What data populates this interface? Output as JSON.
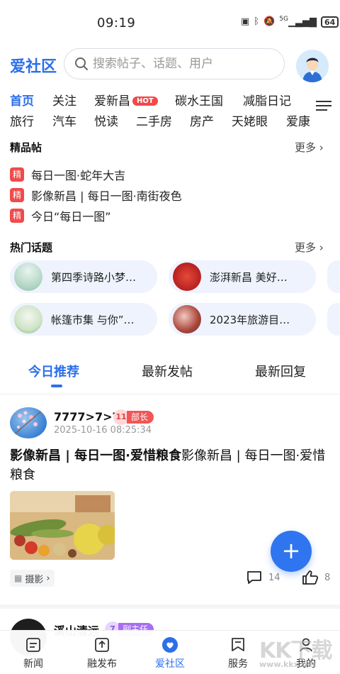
{
  "status": {
    "time": "09:19",
    "battery": "64",
    "signal": "5G"
  },
  "header": {
    "brand": "爱社区",
    "search_placeholder": "搜索帖子、话题、用户"
  },
  "channels_row1": [
    {
      "label": "首页",
      "active": true
    },
    {
      "label": "关注"
    },
    {
      "label": "爱新昌",
      "hot": "HOT"
    },
    {
      "label": "碳水王国"
    },
    {
      "label": "减脂日记"
    }
  ],
  "channels_row2": [
    {
      "label": "旅行"
    },
    {
      "label": "汽车"
    },
    {
      "label": "悦读"
    },
    {
      "label": "二手房"
    },
    {
      "label": "房产"
    },
    {
      "label": "天姥眼"
    },
    {
      "label": "爱康"
    }
  ],
  "featured": {
    "title": "精品帖",
    "more": "更多",
    "badge": "精",
    "items": [
      "每日一图·蛇年大吉",
      "影像新昌 | 每日一图·南街夜色",
      "今日“每日一图”"
    ]
  },
  "topics": {
    "title": "热门话题",
    "more": "更多",
    "items": [
      "第四季诗路小梦…",
      "澎湃新昌 美好…",
      "帐篷市集 与你”…",
      "2023年旅游目…"
    ]
  },
  "feed_tabs": [
    "今日推荐",
    "最新发帖",
    "最新回复"
  ],
  "post": {
    "user": "7777>7>7",
    "level": "11",
    "role": "部长",
    "time": "2025-10-16 08:25:34",
    "title_bold": "影像新昌 | 每日一图·爱惜粮食",
    "title_rest": "影像新昌 | 每日一图·爱惜粮食",
    "tag": "摄影",
    "comments": "14",
    "likes": "8"
  },
  "post2": {
    "user": "溪山清远",
    "level": "7",
    "role": "副主任"
  },
  "tabbar": [
    {
      "label": "新闻"
    },
    {
      "label": "融发布"
    },
    {
      "label": "爱社区",
      "active": true
    },
    {
      "label": "服务"
    },
    {
      "label": "我的"
    }
  ],
  "watermark": {
    "main": "KK下载",
    "sub": "www.kkx.net"
  },
  "colors": {
    "accent": "#2c6fea",
    "hot": "#f04a4a",
    "badge": "#ef4b4b"
  }
}
